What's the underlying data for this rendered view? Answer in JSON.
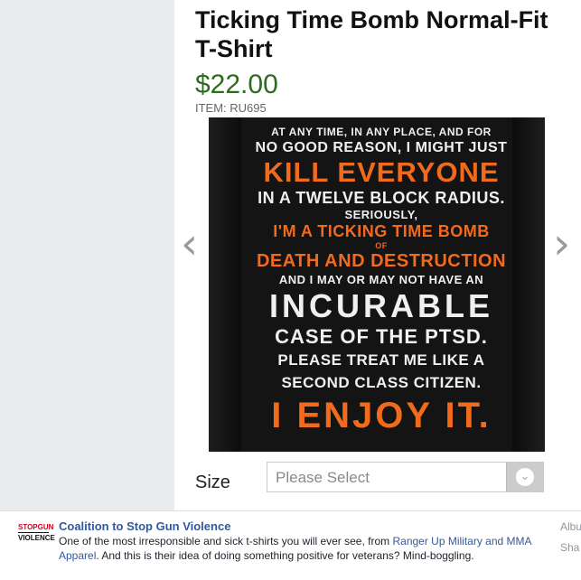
{
  "product": {
    "title": "Ticking Time Bomb Normal-Fit T-Shirt",
    "price": "$22.00",
    "item_code": "ITEM: RU695",
    "shirt_lines": [
      "AT ANY TIME, IN ANY PLACE, AND FOR",
      "NO GOOD REASON, I MIGHT JUST",
      "KILL EVERYONE",
      "IN A TWELVE BLOCK RADIUS.",
      "SERIOUSLY,",
      "I'M A TICKING TIME BOMB",
      "OF",
      "DEATH AND DESTRUCTION",
      "AND I MAY OR MAY NOT HAVE AN",
      "INCURABLE",
      "CASE OF THE PTSD.",
      "PLEASE TREAT ME LIKE A",
      "SECOND CLASS CITIZEN.",
      "I ENJOY IT."
    ],
    "prev_arrow": "‹",
    "next_arrow": "›",
    "size_label": "Size",
    "size_select": {
      "placeholder": "Please Select",
      "dropdown_icon": "chevron-down-icon"
    },
    "colors": {
      "price": "#2f6b1e",
      "shirt_accent": "#f26a1b",
      "shirt_body": "#141414"
    }
  },
  "post": {
    "logo": {
      "line1_a": "STOP",
      "line1_b": "GUN",
      "line2": "VIOLENCE"
    },
    "page_name": "Coalition to Stop Gun Violence",
    "text_before": "One of the most irresponsible and sick t-shirts you will ever see, from ",
    "link": "Ranger Up Military and MMA Apparel",
    "text_after": ". And this is their idea of doing something positive for veterans? Mind-boggling.",
    "side_link_1": "Albu",
    "side_link_2": "Sha",
    "link_color": "#365899"
  }
}
